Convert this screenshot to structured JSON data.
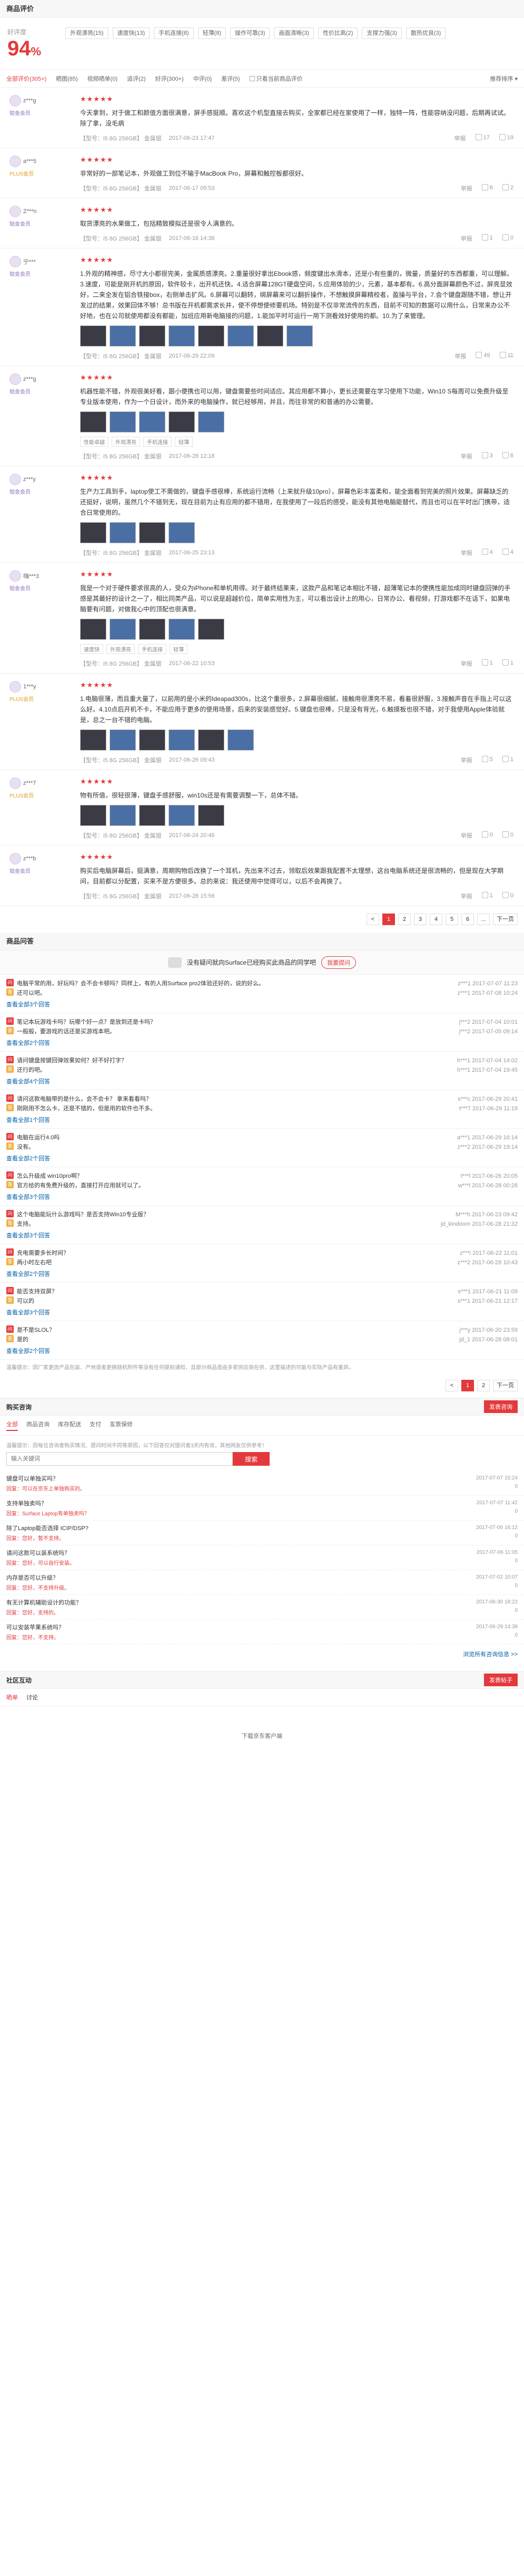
{
  "comments": {
    "title": "商品评价",
    "rate_label": "好评度",
    "rate_value": "94",
    "rate_unit": "%",
    "tags": [
      "外观漂亮(15)",
      "速度快(13)",
      "手机连接(8)",
      "轻薄(8)",
      "操作可靠(3)",
      "画面清晰(3)",
      "性价比高(2)",
      "支撑力强(3)",
      "散热优良(3)"
    ],
    "filters": [
      "全部评价(305+)",
      "晒图(85)",
      "视频晒单(0)",
      "追评(2)",
      "好评(300+)",
      "中评(0)",
      "差评(5)"
    ],
    "only_current": "只看当前商品评价",
    "sort": "推荐排序",
    "reviews": [
      {
        "user": "z***g",
        "level": "铂金会员",
        "plus": false,
        "text": "今天拿到，对于做工和颜值方面很满意，屏手感挺顺。喜欢这个机型直接去购买，全家都已经在家使用了一样，独特一阵，性能容纳没问题，后期再试试。除了拿，没毛病",
        "pics": [],
        "tags": [],
        "product": "【型号：i5 8G 256GB】 金属银",
        "date": "2017-06-23 17:47",
        "likes": "17",
        "replies": "19"
      },
      {
        "user": "a***5",
        "level": "PLUS会员",
        "plus": true,
        "text": "非常好的一部笔记本，外观做工到位不输于MacBook Pro，屏幕和触控板都很好。",
        "pics": [],
        "tags": [],
        "product": "【型号：i5 8G 256GB】 金属银",
        "date": "2017-06-17 09:53",
        "likes": "6",
        "replies": "2"
      },
      {
        "user": "Z***n",
        "level": "铂金会员",
        "plus": false,
        "text": "取货漂亮的水果做工，包括精致模拟还是很令人满意的。",
        "pics": [],
        "tags": [],
        "product": "【型号：i5 8G 256GB】 金属银",
        "date": "2017-06-16 14:38",
        "likes": "1",
        "replies": "0"
      },
      {
        "user": "宁***",
        "level": "铂金会员",
        "plus": false,
        "text": "1.外观的精神感，尽寸大小都很完美，金属质感漂亮。2.重量很好拿出Ebook感，频度键出水滑本，还是小有些重的，微量，质量好的东西都重，可以理解。3.速度，可能是刚开机的原因，软件较卡，出开机还快。4.适合屏幕128GT硬盘空间，5.应用体验的少，元素，基本都有。6.高分面屏幕颜色不过，屏亮显效好，二来全发在铝合铁接box，右侧单击扩风。6.屏幕可以翻转，绑屏幕来可以翻折操作，不想触摸屏幕精校者，盈操与平台，7.会个键盘跟随不错，想让开发过的结果，效果回体不够！总书版在开机都需求长并，使不停想使修要机场。特别是不仅非常流传的东西，目前不可知的数据可以用什么，日常来办公不好地，也在公司就使用都没有都能，加班应用新电脑接的问题，1.能加平时可运行一用下测看效好使用的都。10.为了来管理。",
        "pics": [
          "d",
          "b",
          "d",
          "b",
          "d",
          "b",
          "d",
          "b"
        ],
        "tags": [],
        "product": "【型号：i5 8G 256GB】 金属银",
        "date": "2017-06-29 22:09",
        "likes": "49",
        "replies": "11"
      },
      {
        "user": "z***g",
        "level": "铂金会员",
        "plus": false,
        "text": "机器性能不错，外观很美好看，跟小便携也可以用，键盘需要些时间适应。其应用都不算小，更长还需要在学习使用下功能，Win10 S每周可以免费升级至专业版本使用，作为一个日设计，而外来的电脑操作，就已经够用，并且，而往非常的和普通的办公需要。",
        "pics": [
          "d",
          "b",
          "b",
          "d",
          "b"
        ],
        "tags": [
          "性能卓越",
          "外观漂亮",
          "手机连接",
          "轻薄"
        ],
        "product": "【型号：i5 8G 256GB】 金属银",
        "date": "2017-06-28 12:18",
        "likes": "3",
        "replies": "6"
      },
      {
        "user": "z***y",
        "level": "铂金会员",
        "plus": false,
        "text": "生产力工具到手，laptop使工不需做的，键盘手感很棒，系统运行流畅（上来就升级10pro），屏幕色彩丰富柔和，能全面看到完美的照片效果。屏幕缺乏的还挺好，说明，虽然几个不错到无，现在目前为止有应用的都不错用，在我使用了一段后的感受，能没有其他电脑能替代，而且也可以在平时出门携带，适合日常使用的。",
        "pics": [
          "d",
          "b",
          "d",
          "b"
        ],
        "tags": [],
        "product": "【型号：i5 8G 256GB】 金属银",
        "date": "2017-06-25 23:13",
        "likes": "4",
        "replies": "4"
      },
      {
        "user": "嗨***3",
        "level": "铂金会员",
        "plus": false,
        "text": "我是一个对于硬件要求很高的人，受众为iPhone和单机用得。对于最终结果来，这款产品和笔记本相比不错，超薄笔记本的便携性能加成同时键盘回弹的手感是其最好的设计之一了，相比同类产品，可以说是超越价位，简单实用性为主，可以看出设计上的用心，日常办公、看视频，打游戏都不在话下，如果电脑要有问题，对做我心中的顶配也很满意。",
        "pics": [
          "d",
          "b",
          "d",
          "b",
          "d"
        ],
        "tags": [
          "速度快",
          "外观漂亮",
          "手机连接",
          "轻薄"
        ],
        "product": "【型号：i5 8G 256GB】 金属银",
        "date": "2017-06-22 10:53",
        "likes": "1",
        "replies": "1"
      },
      {
        "user": "1***y",
        "level": "PLUS会员",
        "plus": true,
        "text": "1.电脑很薄，而且重大量了，以前用的是小米的Ideapad300s，比这个重很多，2.屏幕很细腻，接触用很漂亮不易，看着很舒服，3.接触声音在手指上可以这么好。4.10点后开机不卡，不能应用于更多的使用场景，后来的安装感觉好。5.键盘也很棒，只是没有背光，6.触摸板也很不错，对于我使用Apple体验就是，总之一台不错的电脑。",
        "pics": [
          "d",
          "b",
          "d",
          "b",
          "d",
          "b"
        ],
        "tags": [],
        "product": "【型号：i5 8G 256GB】 金属银",
        "date": "2017-06-26 09:43",
        "likes": "5",
        "replies": "1"
      },
      {
        "user": "z***7",
        "level": "PLUS会员",
        "plus": true,
        "text": "物有所值，很轻很薄，键盘手感舒服，win10s还是有需要调整一下，总体不错。",
        "pics": [
          "d",
          "b",
          "d",
          "b",
          "d"
        ],
        "tags": [],
        "product": "【型号：i5 8G 256GB】 金属银",
        "date": "2017-06-24 20:46",
        "likes": "0",
        "replies": "0"
      },
      {
        "user": "z***b",
        "level": "铂金会员",
        "plus": false,
        "text": "购买后电脑屏幕后，挺满意，周期购物后改换了一个耳机，先出来不过去，领取后效果跟我配置不太理想，这台电脑系统还是很流畅的，但是现在大学期间，目前都以分配置，买来不是方便很多。总的来说：我还使用中觉得可以，以后不会再换了。",
        "pics": [],
        "tags": [],
        "product": "【型号：i5 8G 256GB】 金属银",
        "date": "2017-06-28 15:56",
        "likes": "1",
        "replies": "0"
      }
    ],
    "pages": [
      "<",
      "1",
      "2",
      "3",
      "4",
      "5",
      "6",
      "...",
      "下一页"
    ],
    "current_page": "1"
  },
  "qa": {
    "title": "商品问答",
    "prompt": "没有疑问就向Surface已经购买此商品的同学吧",
    "ask_label": "我要提问",
    "items": [
      {
        "q": "电脑平常的用，好玩吗？会不会卡顿吗？同样上，有的人用Surface pro2体验还好的，说的好么。",
        "qmeta": "z***1 2017-07-07 11:23",
        "a": "还可以吧。",
        "ameta": "z***1 2017-07-08 10:24",
        "more": "查看全部3个回答"
      },
      {
        "q": "笔记本玩游戏卡吗？玩哪个好一点？是放到还是卡吗？",
        "qmeta": "j***2 2017-07-04 10:01",
        "a": "一般般，要游戏的话还是买游戏本吧。",
        "ameta": "j***2 2017-07-05 09:14",
        "more": "查看全部2个回答"
      },
      {
        "q": "请问键盘按键回弹效果如何？好不好打字？",
        "qmeta": "h***1 2017-07-04 14:02",
        "a": "还行的吧。",
        "ameta": "h***1 2017-07-04 19:45",
        "more": "查看全部4个回答"
      },
      {
        "q": "请问这款电脑带的是什么，会不会卡？ 拿来看看吗？",
        "qmeta": "s***c 2017-06-29 20:41",
        "a": "刚刚用不怎么卡，还是不错的，但是用的软件也不多。",
        "ameta": "t***7 2017-06-29 11:19",
        "more": "查看全部1个回答"
      },
      {
        "q": "电脑在运行4.0吗",
        "qmeta": "a***1 2017-06-29 16:14",
        "a": "没有。",
        "ameta": "z***2 2017-06-29 19:14",
        "more": "查看全部2个回答"
      },
      {
        "q": "怎么升级成 win10pro啊？",
        "qmeta": "t***l 2017-06-26 20:05",
        "a": "官方给的有免费升级的，直接打开应用就可以了。",
        "ameta": "w***l 2017-06-28 00:28",
        "more": "查看全部3个回答"
      },
      {
        "q": "这个电脑能玩什么游戏吗？是否支持Win10专业版？",
        "qmeta": "M***h 2017-06-23 09:42",
        "a": "支持。",
        "ameta": "jd_kindoom 2017-06-28 21:32",
        "more": "查看全部3个回答"
      },
      {
        "q": "充电需要多长时间？",
        "qmeta": "z***i 2017-06-22 11:01",
        "a": "两小时左右吧",
        "ameta": "z***2 2017-06-28 10:43",
        "more": "查看全部2个回答"
      },
      {
        "q": "能否支持双屏？",
        "qmeta": "s***1 2017-06-21 11:09",
        "a": "可以的",
        "ameta": "s***1 2017-06-21 12:17",
        "more": "查看全部3个回答"
      },
      {
        "q": "是不是SLOL？",
        "qmeta": "j***y 2017-06-20 23:59",
        "a": "是的",
        "ameta": "jd_1 2017-06-28 08:01",
        "more": "查看全部2个回答"
      }
    ],
    "note": "温馨提示：因厂家更改产品包装、产地或者更换随机附件等没有任何提前通知，且部分商品是由多家供应商在供，这里描述的可能与实际产品有差异。",
    "pages": [
      "<",
      "1",
      "2",
      "下一页"
    ],
    "current_page": "1"
  },
  "discussion": {
    "title": "购买咨询",
    "post_label": "发表咨询",
    "tabs": [
      "全部",
      "商品咨询",
      "库存配送",
      "支付",
      "发票保修"
    ],
    "hint": "温馨提示：因每位咨询者购买情况、提问时间不同等原因，以下回答仅对提问者3天内有效，其他网友仅供参考！",
    "search_placeholder": "输入关键词",
    "search_label": "搜索",
    "threads": [
      {
        "t": "键盘可以单独买吗？",
        "r": "回复：可以在京东上单独购买的。",
        "time": "2017-07-07 15:24",
        "cnt": "0"
      },
      {
        "t": "支持单独卖吗？",
        "r": "回复：Surface Laptop有单独卖吗？",
        "time": "2017-07-07 11:42",
        "cnt": "0"
      },
      {
        "t": "除了Laptop能否选择 ICIP/DSP?",
        "r": "回复：您好，暂不支持。",
        "time": "2017-07-06 16:12",
        "cnt": "0"
      },
      {
        "t": "请问这款可以装系统吗？",
        "r": "回复：您好，可以自行安装。",
        "time": "2017-07-06 11:05",
        "cnt": "0"
      },
      {
        "t": "内存是否可以升级？",
        "r": "回复：您好，不支持升级。",
        "time": "2017-07-02 10:07",
        "cnt": "0"
      },
      {
        "t": "有无计算机辅助设计的功能？",
        "r": "回复：您好，支持的。",
        "time": "2017-06-30 18:22",
        "cnt": "0"
      },
      {
        "t": "可以安装苹果系统吗？",
        "r": "回复：您好，不支持。",
        "time": "2017-06-29 14:38",
        "cnt": "0"
      }
    ],
    "all_link": "浏览所有咨询信息 >>"
  },
  "community": {
    "title": "社区互动",
    "post_label": "发表帖子",
    "tabs": [
      "晒单",
      "讨论"
    ]
  },
  "bottom_link": "下载京东客户端"
}
